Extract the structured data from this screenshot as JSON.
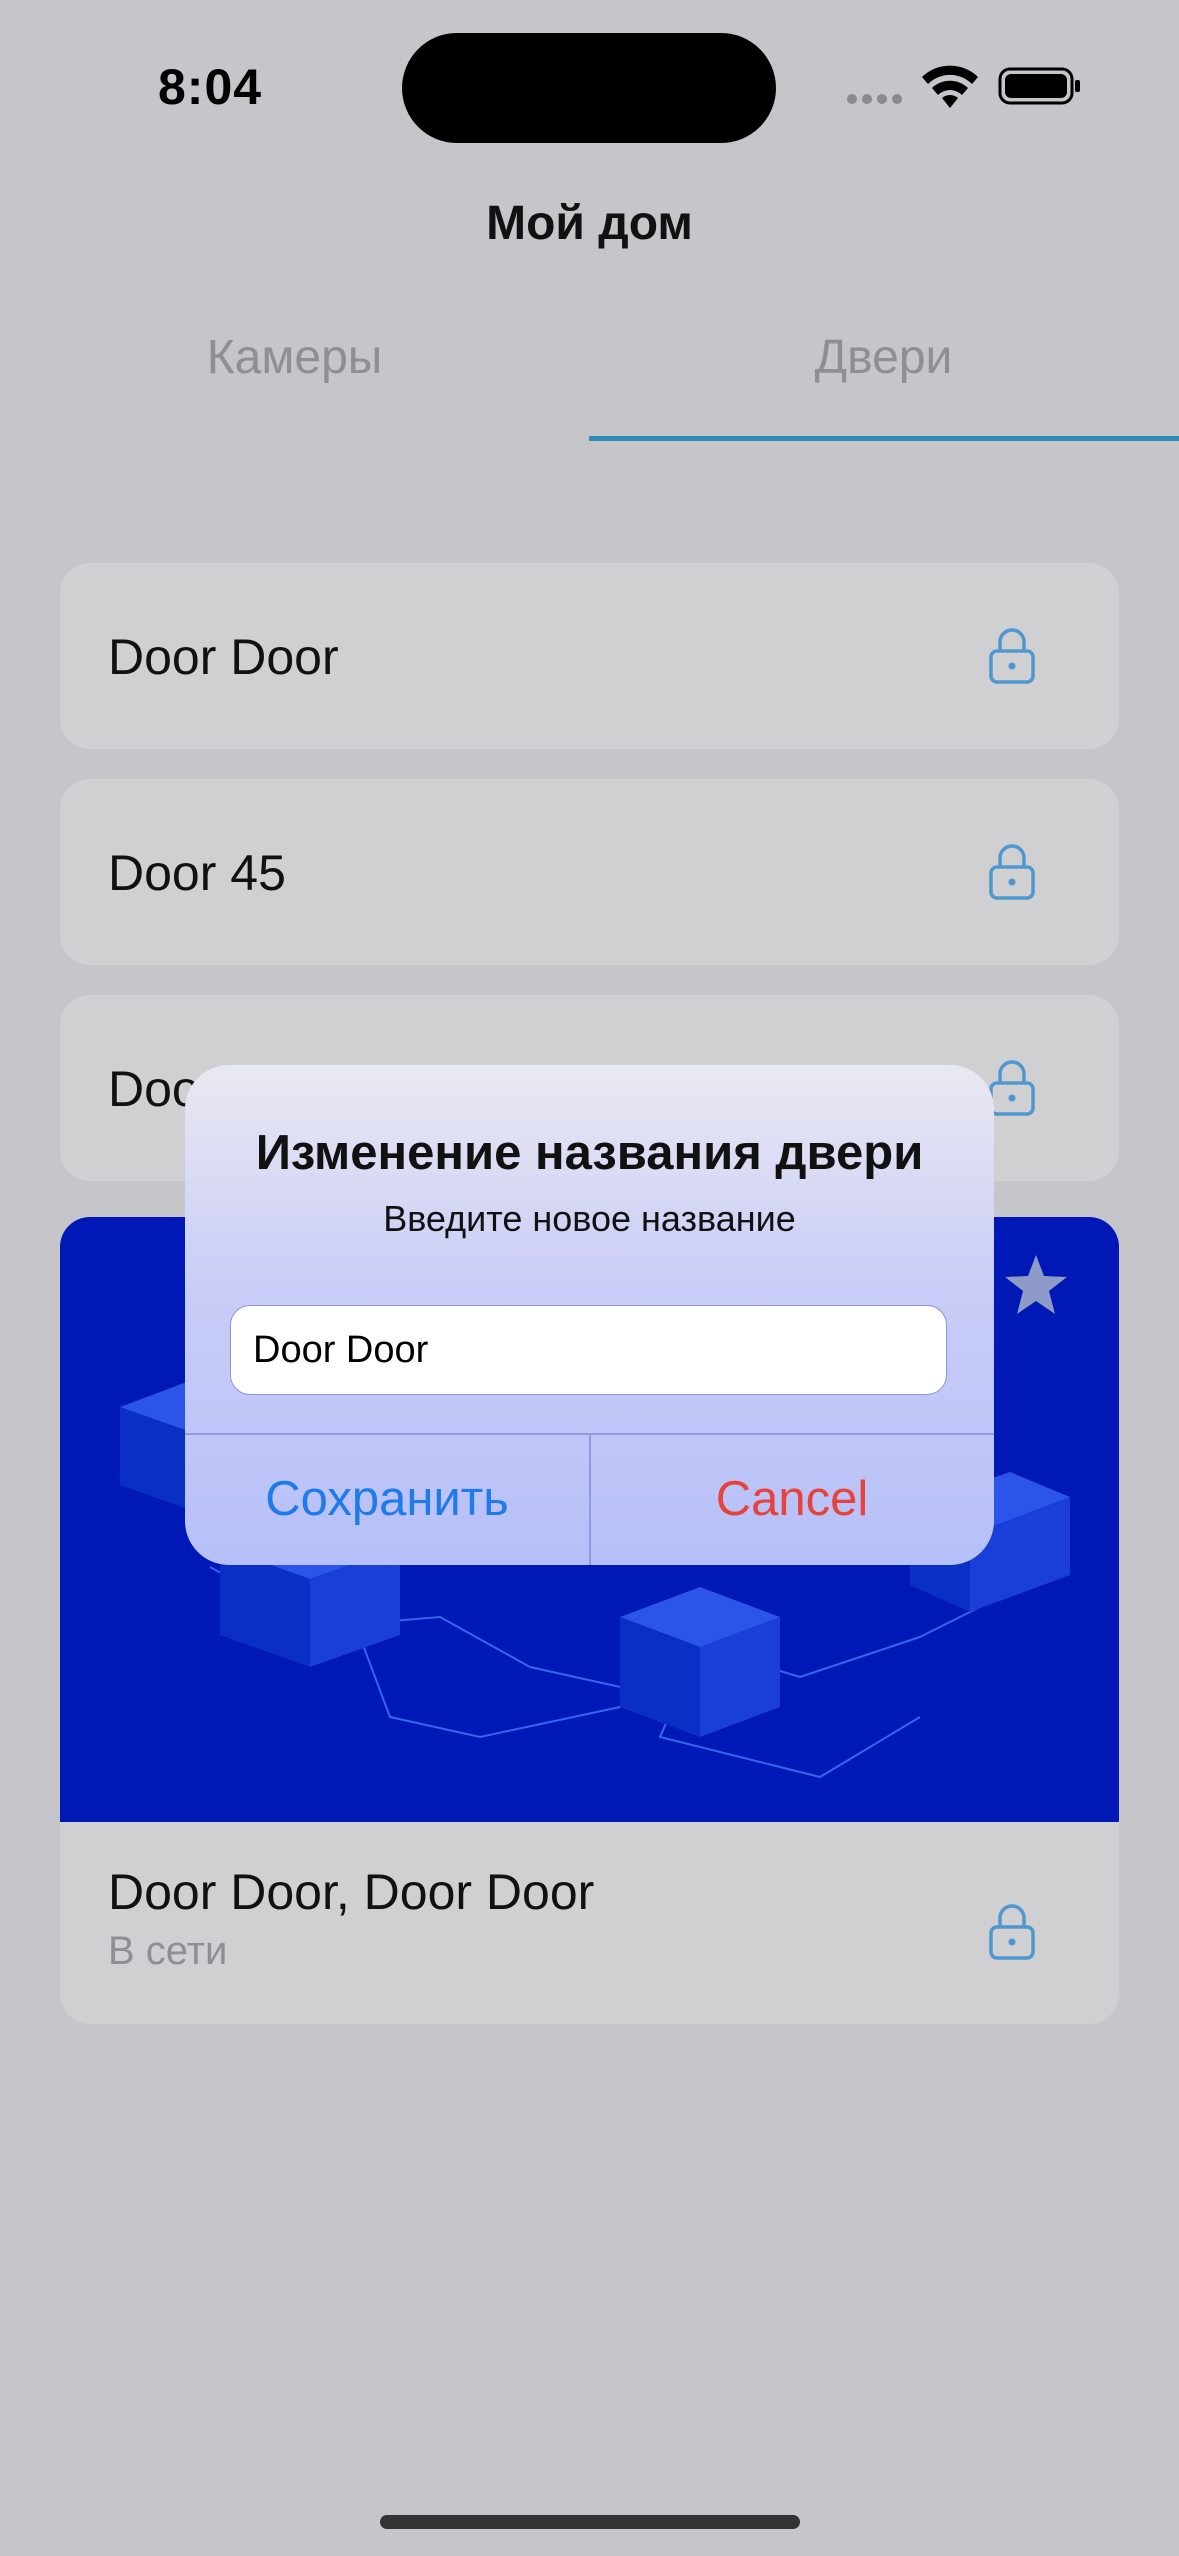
{
  "status_bar": {
    "time": "8:04"
  },
  "nav": {
    "title": "Мой дом"
  },
  "tabs": [
    {
      "label": "Камеры",
      "selected": false
    },
    {
      "label": "Двери",
      "selected": true
    }
  ],
  "doors": [
    {
      "name": "Door Door",
      "icon": "lock-icon"
    },
    {
      "name": "Door 45",
      "icon": "lock-icon"
    },
    {
      "name": "Doo",
      "icon": "lock-icon"
    }
  ],
  "featured_door": {
    "name": "Door Door, Door Door",
    "status": "В сети",
    "favorite_icon": "star-icon",
    "icon": "lock-icon"
  },
  "dialog": {
    "title": "Изменение названия двери",
    "message": "Введите новое название",
    "input_value": "Door Door",
    "save_label": "Сохранить",
    "cancel_label": "Cancel"
  },
  "colors": {
    "accent": "#2E8BB8",
    "save": "#1F7AEA",
    "cancel": "#E8423C",
    "illustration_bg": "#0018B6"
  }
}
